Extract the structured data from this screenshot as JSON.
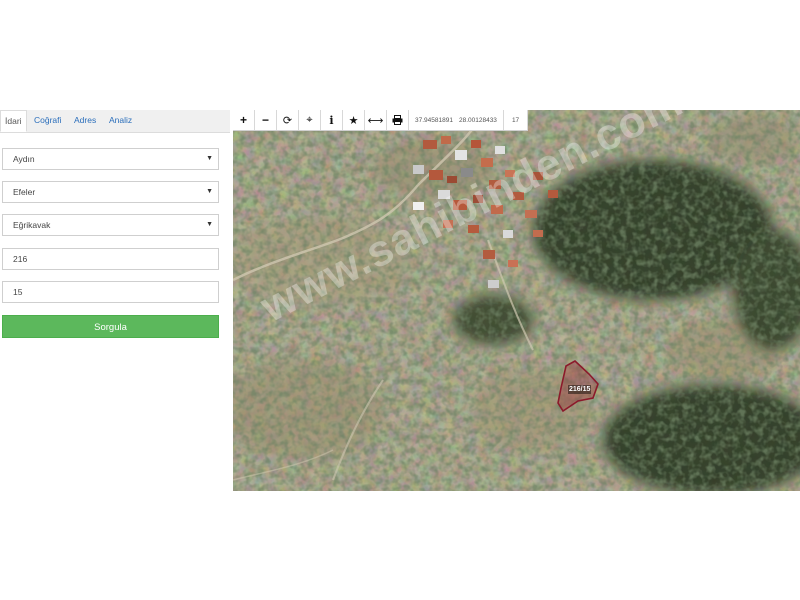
{
  "tabs": [
    {
      "label": "İdari",
      "active": true
    },
    {
      "label": "Coğrafi",
      "active": false
    },
    {
      "label": "Adres",
      "active": false
    },
    {
      "label": "Analiz",
      "active": false
    }
  ],
  "form": {
    "il": {
      "value": "Aydın"
    },
    "ilce": {
      "value": "Efeler"
    },
    "mahalle": {
      "value": "Eğrikavak"
    },
    "ada": {
      "value": "216"
    },
    "parsel": {
      "value": "15"
    },
    "submit_label": "Sorgula",
    "submit_color": "#5cb85c"
  },
  "map": {
    "toolbar": {
      "icons": [
        "zoom-in-icon",
        "zoom-out-icon",
        "refresh-icon",
        "locate-icon",
        "info-icon",
        "favorite-star-icon",
        "measure-icon",
        "print-icon"
      ],
      "lat": "37.94581891",
      "lon": "28.00128433",
      "zoom_level": "17"
    },
    "parcel_label": "216/15",
    "parcel_color": "#8b1a2b",
    "watermark": "www.sahibinden.com"
  }
}
